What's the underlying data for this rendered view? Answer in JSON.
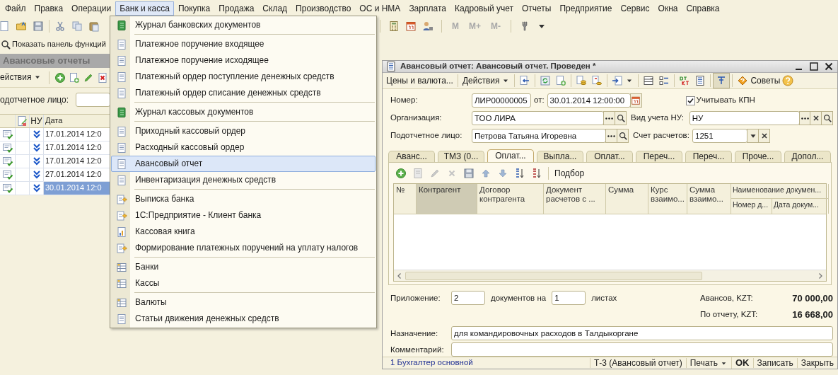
{
  "menu_bar": {
    "items": [
      {
        "label": "Файл",
        "selected": false
      },
      {
        "label": "Правка",
        "selected": false
      },
      {
        "label": "Операции",
        "selected": false
      },
      {
        "label": "Банк и касса",
        "selected": true
      },
      {
        "label": "Покупка",
        "selected": false
      },
      {
        "label": "Продажа",
        "selected": false
      },
      {
        "label": "Склад",
        "selected": false
      },
      {
        "label": "Производство",
        "selected": false
      },
      {
        "label": "ОС и НМА",
        "selected": false
      },
      {
        "label": "Зарплата",
        "selected": false
      },
      {
        "label": "Кадровый учет",
        "selected": false
      },
      {
        "label": "Отчеты",
        "selected": false
      },
      {
        "label": "Предприятие",
        "selected": false
      },
      {
        "label": "Сервис",
        "selected": false
      },
      {
        "label": "Окна",
        "selected": false
      },
      {
        "label": "Справка",
        "selected": false
      }
    ]
  },
  "toolbar": {
    "memory_buttons": [
      "M",
      "M+",
      "M-"
    ]
  },
  "function_panel_button": "Показать панель функций",
  "list_window": {
    "title": "Авансовые отчеты",
    "actions_button": "ействия",
    "filter_label": "одотчетное лицо:",
    "columns": [
      "НУ",
      "Дата"
    ],
    "rows": [
      {
        "date": "17.01.2014 12:0",
        "selected": false
      },
      {
        "date": "17.01.2014 12:0",
        "selected": false
      },
      {
        "date": "17.01.2014 12:0",
        "selected": false
      },
      {
        "date": "27.01.2014 12:0",
        "selected": false
      },
      {
        "date": "30.01.2014 12:0",
        "selected": true
      }
    ]
  },
  "bank_menu": {
    "groups": [
      [
        {
          "label": "Журнал банковских документов",
          "kind": "journal",
          "selected": false
        }
      ],
      [
        {
          "label": "Платежное поручение входящее",
          "kind": "document",
          "selected": false
        },
        {
          "label": "Платежное поручение исходящее",
          "kind": "document",
          "selected": false
        },
        {
          "label": "Платежный ордер поступление денежных средств",
          "kind": "document",
          "selected": false
        },
        {
          "label": "Платежный ордер списание денежных средств",
          "kind": "document",
          "selected": false
        }
      ],
      [
        {
          "label": "Журнал кассовых документов",
          "kind": "journal",
          "selected": false
        }
      ],
      [
        {
          "label": "Приходный кассовый ордер",
          "kind": "document",
          "selected": false
        },
        {
          "label": "Расходный кассовый ордер",
          "kind": "document",
          "selected": false
        },
        {
          "label": "Авансовый отчет",
          "kind": "document",
          "selected": true
        },
        {
          "label": "Инвентаризация денежных средств",
          "kind": "document",
          "selected": false
        }
      ],
      [
        {
          "label": "Выписка банка",
          "kind": "processing",
          "selected": false
        },
        {
          "label": "1С:Предприятие - Клиент банка",
          "kind": "processing",
          "selected": false
        },
        {
          "label": "Кассовая книга",
          "kind": "report",
          "selected": false
        },
        {
          "label": "Формирование платежных поручений на уплату налогов",
          "kind": "processing",
          "selected": false
        }
      ],
      [
        {
          "label": "Банки",
          "kind": "catalog",
          "selected": false
        },
        {
          "label": "Кассы",
          "kind": "catalog",
          "selected": false
        }
      ],
      [
        {
          "label": "Валюты",
          "kind": "catalog",
          "selected": false
        },
        {
          "label": "Статьи движения денежных средств",
          "kind": "document",
          "selected": false
        }
      ]
    ]
  },
  "document_window": {
    "title": "Авансовый отчет: Авансовый отчет. Проведен *",
    "toolbar": {
      "prices_button": "Цены и валюта...",
      "actions_button": "Действия",
      "advice_button": "Советы"
    },
    "number_label": "Номер:",
    "number": "ЛИР00000005",
    "date_label": "от:",
    "date": "30.01.2014 12:00:00",
    "kpn_checkbox": {
      "label": "Учитывать КПН",
      "checked": true
    },
    "organization_label": "Организация:",
    "organization": "ТОО ЛИРА",
    "tax_label": "Вид учета НУ:",
    "tax_accounting": "НУ",
    "person_label": "Подотчетное лицо:",
    "person": "Петрова Татьяна Игоревна",
    "account_label": "Счет расчетов:",
    "account": "1251",
    "tabs": [
      {
        "label": "Аванс...",
        "selected": false
      },
      {
        "label": "ТМЗ (0...",
        "selected": false
      },
      {
        "label": "Оплат...",
        "selected": true
      },
      {
        "label": "Выпла...",
        "selected": false
      },
      {
        "label": "Оплат...",
        "selected": false
      },
      {
        "label": "Переч...",
        "selected": false
      },
      {
        "label": "Переч...",
        "selected": false
      },
      {
        "label": "Проче...",
        "selected": false
      },
      {
        "label": "Допол...",
        "selected": false
      }
    ],
    "table": {
      "pick_button": "Подбор",
      "columns": [
        {
          "label": "№",
          "selected": false
        },
        {
          "label": "Контрагент",
          "selected": true
        },
        {
          "label": "Договор контрагента",
          "selected": false
        },
        {
          "label": "Документ расчетов с ...",
          "selected": false
        },
        {
          "label": "Сумма",
          "selected": false
        },
        {
          "label": "Курс взаимо...",
          "selected": false
        },
        {
          "label": "Сумма взаимо...",
          "selected": false
        },
        {
          "label": "Наименование докумен...",
          "selected": false,
          "subcolumns": [
            "Номер д...",
            "Дата докум..."
          ]
        }
      ]
    },
    "attachment_label": "Приложение:",
    "attachment_docs": "2",
    "docs_text": "документов на",
    "sheets": "1",
    "sheets_text": "листах",
    "advances_label": "Авансов, KZT:",
    "advances": "70 000,00",
    "report_label": "По отчету, KZT:",
    "report_total": "16 668,00",
    "purpose_label": "Назначение:",
    "purpose": "для командировочных расходов в Талдыкоргане",
    "comment_label": "Комментарий:",
    "status_bar": {
      "user": "1 Бухгалтер основной",
      "print_form_button": "Т-3 (Авансовый отчет)",
      "print_button": "Печать",
      "ok_button": "OK",
      "save_button": "Записать",
      "close_button": "Закрыть"
    }
  }
}
